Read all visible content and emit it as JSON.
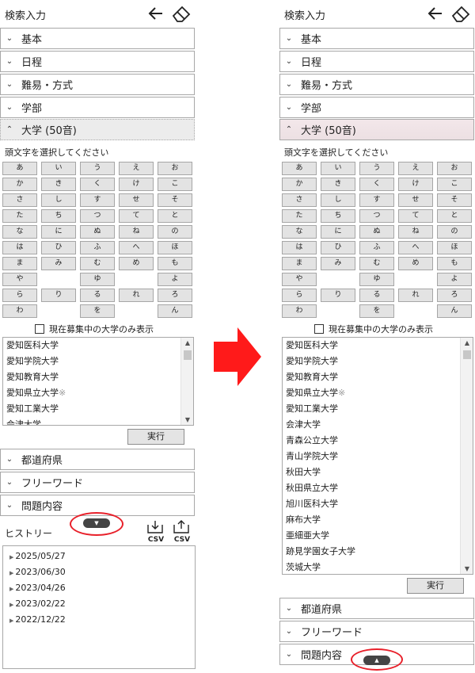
{
  "header": {
    "title": "検索入力",
    "back_icon": "back-arrow-icon",
    "clear_icon": "eraser-icon"
  },
  "sections": {
    "basic": "基本",
    "schedule": "日程",
    "difficulty": "難易・方式",
    "faculty": "学部",
    "university": "大学 (50音)",
    "prefecture": "都道府県",
    "freeword": "フリーワード",
    "questions": "問題内容"
  },
  "kana_prompt": "頭文字を選択してください",
  "kana_rows": [
    [
      "あ",
      "い",
      "う",
      "え",
      "お"
    ],
    [
      "か",
      "き",
      "く",
      "け",
      "こ"
    ],
    [
      "さ",
      "し",
      "す",
      "せ",
      "そ"
    ],
    [
      "た",
      "ち",
      "つ",
      "て",
      "と"
    ],
    [
      "な",
      "に",
      "ぬ",
      "ね",
      "の"
    ],
    [
      "は",
      "ひ",
      "ふ",
      "へ",
      "ほ"
    ],
    [
      "ま",
      "み",
      "む",
      "め",
      "も"
    ],
    [
      "や",
      "",
      "ゆ",
      "",
      "よ"
    ],
    [
      "ら",
      "り",
      "る",
      "れ",
      "ろ"
    ],
    [
      "わ",
      "",
      "を",
      "",
      "ん"
    ]
  ],
  "recruiting_only_label": "現在募集中の大学のみ表示",
  "recruiting_only_checked": false,
  "universities_left": [
    "愛知医科大学",
    "愛知学院大学",
    "愛知教育大学",
    "愛知県立大学",
    "愛知工業大学",
    "会津大学"
  ],
  "universities_right": [
    "愛知医科大学",
    "愛知学院大学",
    "愛知教育大学",
    "愛知県立大学",
    "愛知工業大学",
    "会津大学",
    "青森公立大学",
    "青山学院大学",
    "秋田大学",
    "秋田県立大学",
    "旭川医科大学",
    "麻布大学",
    "亜細亜大学",
    "跡見学園女子大学",
    "茨城大学"
  ],
  "mark_suffix": "※",
  "execute_label": "実行",
  "history": {
    "label": "ヒストリー",
    "export_label": "CSV",
    "import_label": "CSV",
    "items": [
      "2025/05/27",
      "2023/06/30",
      "2023/04/26",
      "2023/02/22",
      "2022/12/22"
    ]
  },
  "collapse_toggle_symbol": "▼",
  "expand_toggle_symbol": "▲",
  "colors": {
    "highlight": "#e8202a",
    "arrow": "#ff1a1a",
    "toggle": "#444444"
  }
}
